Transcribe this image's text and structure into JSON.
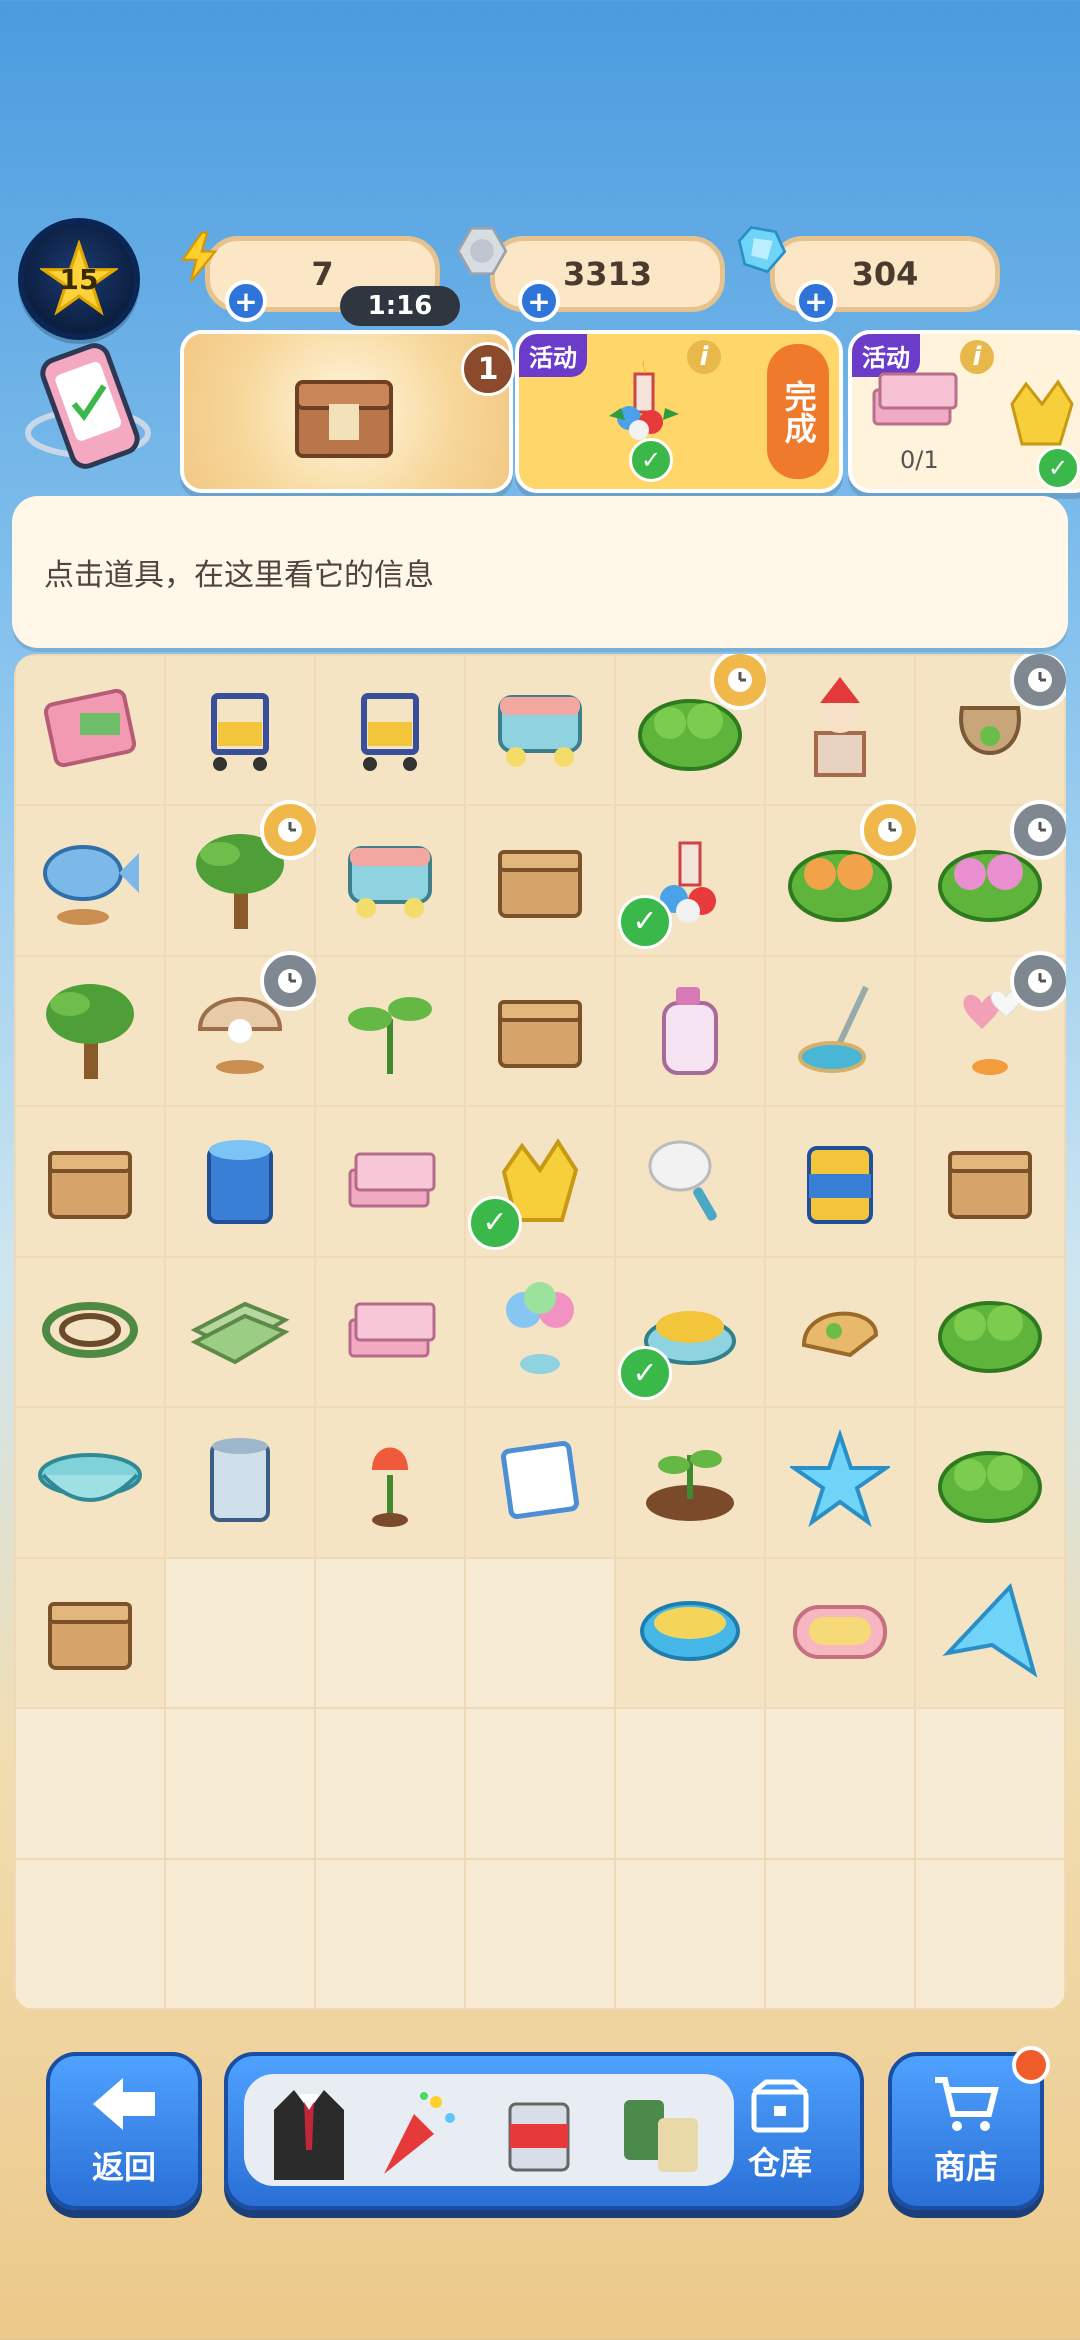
{
  "header": {
    "level": "15",
    "energy": "7",
    "energy_timer": "1:16",
    "coins": "3313",
    "gems": "304"
  },
  "tasks": {
    "card1_badge": "1",
    "card2_tag": "活动",
    "card2_button": "完成",
    "card3_tag": "活动",
    "card3_progress": "0/1"
  },
  "info_panel": {
    "text": "点击道具，在这里看它的信息"
  },
  "grid": {
    "items": [
      {
        "name": "pink-wallet-icon",
        "clock": ""
      },
      {
        "name": "cleaning-cart-icon",
        "clock": ""
      },
      {
        "name": "janitor-cart-icon",
        "clock": ""
      },
      {
        "name": "toy-cart-icon",
        "clock": ""
      },
      {
        "name": "bush-icon",
        "clock": "gold"
      },
      {
        "name": "santa-chimney-icon",
        "clock": ""
      },
      {
        "name": "seed-bag-icon",
        "clock": "gray"
      },
      {
        "name": "whale-globe-icon",
        "clock": ""
      },
      {
        "name": "palm-tree-icon",
        "clock": "gold"
      },
      {
        "name": "toy-box-icon",
        "clock": ""
      },
      {
        "name": "toolbox-icon",
        "clock": ""
      },
      {
        "name": "candle-ornaments-icon",
        "clock": "",
        "check": true
      },
      {
        "name": "flower-bush-icon",
        "clock": "gold"
      },
      {
        "name": "pink-flower-bush-icon",
        "clock": "gray"
      },
      {
        "name": "palm-tree-large-icon",
        "clock": ""
      },
      {
        "name": "pearl-shell-icon",
        "clock": "gray"
      },
      {
        "name": "sprout-icon",
        "clock": ""
      },
      {
        "name": "wooden-crate-tools-icon",
        "clock": ""
      },
      {
        "name": "detergent-bottle-icon",
        "clock": ""
      },
      {
        "name": "floor-mop-icon",
        "clock": ""
      },
      {
        "name": "heart-balloons-icon",
        "clock": "gray"
      },
      {
        "name": "tool-crate-icon",
        "clock": ""
      },
      {
        "name": "blue-paint-bucket-icon",
        "clock": ""
      },
      {
        "name": "cash-stack-icon",
        "clock": ""
      },
      {
        "name": "yellow-gloves-icon",
        "clock": "",
        "check": true
      },
      {
        "name": "feather-duster-icon",
        "clock": ""
      },
      {
        "name": "yellow-paint-can-icon",
        "clock": ""
      },
      {
        "name": "empty-crate-icon",
        "clock": ""
      },
      {
        "name": "rope-coil-icon",
        "clock": ""
      },
      {
        "name": "green-cloth-icon",
        "clock": ""
      },
      {
        "name": "money-bills-icon",
        "clock": ""
      },
      {
        "name": "balloon-bunch-icon",
        "clock": ""
      },
      {
        "name": "scrub-brush-icon",
        "clock": "",
        "check": true
      },
      {
        "name": "seed-scoop-icon",
        "clock": ""
      },
      {
        "name": "green-shrub-icon",
        "clock": ""
      },
      {
        "name": "wash-basin-icon",
        "clock": ""
      },
      {
        "name": "paint-tin-icon",
        "clock": ""
      },
      {
        "name": "tulip-icon",
        "clock": ""
      },
      {
        "name": "towel-icon",
        "clock": ""
      },
      {
        "name": "seedling-soil-icon",
        "clock": ""
      },
      {
        "name": "blue-star-icon",
        "clock": ""
      },
      {
        "name": "light-bush-icon",
        "clock": ""
      },
      {
        "name": "green-crate-icon",
        "clock": ""
      },
      {
        "name": "",
        "clock": ""
      },
      {
        "name": "",
        "clock": ""
      },
      {
        "name": "",
        "clock": ""
      },
      {
        "name": "sponge-icon",
        "clock": ""
      },
      {
        "name": "soap-bar-icon",
        "clock": ""
      },
      {
        "name": "blue-triangle-icon",
        "clock": ""
      }
    ]
  },
  "bottom_bar": {
    "back_label": "返回",
    "storage_label": "仓库",
    "shop_label": "商店"
  },
  "colors": {
    "accent_blue": "#2f74d8",
    "pill_bg": "#fbe6c6",
    "activity_purple": "#6a3cc9",
    "done_orange": "#f07a2b",
    "check_green": "#3ab94a",
    "alert_red": "#f05d2b"
  }
}
